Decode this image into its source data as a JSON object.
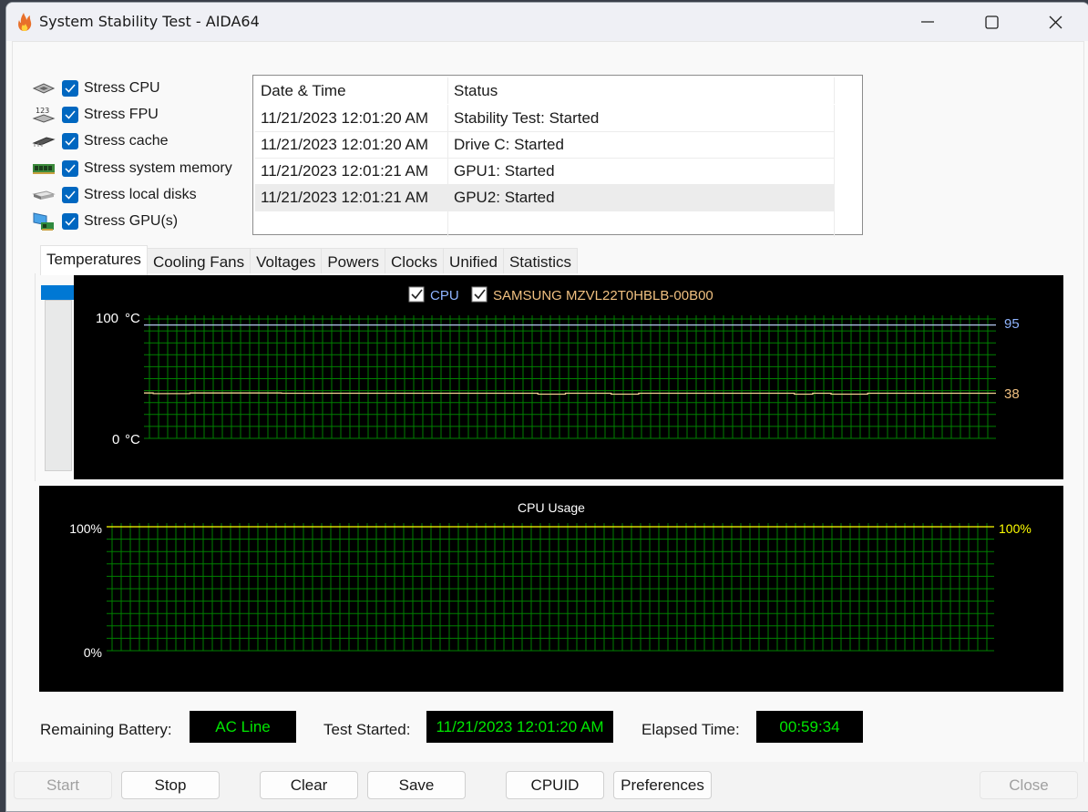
{
  "window": {
    "title": "System Stability Test - AIDA64",
    "controls": {
      "minimize": "minimize",
      "maximize": "maximize",
      "close": "close"
    }
  },
  "stress_options": [
    {
      "label": "Stress CPU",
      "checked": true,
      "icon": "cpu-chip-icon"
    },
    {
      "label": "Stress FPU",
      "checked": true,
      "icon": "fpu-chip-icon"
    },
    {
      "label": "Stress cache",
      "checked": true,
      "icon": "cache-chip-icon"
    },
    {
      "label": "Stress system memory",
      "checked": true,
      "icon": "memory-module-icon"
    },
    {
      "label": "Stress local disks",
      "checked": true,
      "icon": "disk-drive-icon"
    },
    {
      "label": "Stress GPU(s)",
      "checked": true,
      "icon": "gpu-card-icon"
    }
  ],
  "log": {
    "columns": [
      "Date & Time",
      "Status"
    ],
    "rows": [
      {
        "datetime": "11/21/2023 12:01:20 AM",
        "status": "Stability Test: Started"
      },
      {
        "datetime": "11/21/2023 12:01:20 AM",
        "status": "Drive C: Started"
      },
      {
        "datetime": "11/21/2023 12:01:21 AM",
        "status": "GPU1: Started"
      },
      {
        "datetime": "11/21/2023 12:01:21 AM",
        "status": "GPU2: Started",
        "selected": true
      }
    ]
  },
  "tabs": [
    {
      "label": "Temperatures",
      "active": true
    },
    {
      "label": "Cooling Fans"
    },
    {
      "label": "Voltages"
    },
    {
      "label": "Powers"
    },
    {
      "label": "Clocks"
    },
    {
      "label": "Unified"
    },
    {
      "label": "Statistics"
    }
  ],
  "colors": {
    "grid": "#008000",
    "cpu_series": "#b4c8f0",
    "disk_series": "#f0d090",
    "usage_series": "#ffff00",
    "status_value": "#00e600",
    "checkbox_accent": "#0067c0"
  },
  "chart_data": [
    {
      "type": "line",
      "title": "Temperatures",
      "legend": [
        {
          "name": "CPU",
          "checked": true,
          "color": "#8fb4ff"
        },
        {
          "name": "SAMSUNG MZVL22T0HBLB-00B00",
          "checked": true,
          "color": "#f0c080"
        }
      ],
      "ylabel_top": "100",
      "ylabel_bottom": "0",
      "unit": "°C",
      "ylim": [
        0,
        100
      ],
      "grid": true,
      "series": [
        {
          "name": "CPU",
          "current_label": "95",
          "values": [
            95,
            95,
            95,
            95,
            95,
            95,
            95,
            95,
            95,
            95,
            95,
            95,
            95,
            95,
            95,
            95,
            95,
            95,
            95,
            95,
            95,
            95,
            95,
            95,
            95,
            95,
            95,
            95,
            95,
            95,
            95,
            95,
            95,
            95,
            95,
            95,
            95,
            95,
            95,
            95,
            95,
            95,
            95,
            95,
            95,
            95,
            95,
            95,
            95,
            95,
            95,
            95,
            95,
            95,
            95,
            95,
            95,
            95,
            95,
            95,
            95,
            95,
            95,
            95,
            95,
            95,
            95,
            95,
            95,
            95,
            95,
            95,
            95,
            95,
            95,
            95,
            95,
            95,
            95,
            95,
            95,
            95,
            95,
            95,
            95,
            95,
            95,
            95,
            95,
            95,
            95,
            95,
            95
          ]
        },
        {
          "name": "SAMSUNG MZVL22T0HBLB-00B00",
          "current_label": "38",
          "values": [
            38,
            37.5,
            37.5,
            37.5,
            37.5,
            38,
            38,
            38,
            38,
            38,
            38,
            38,
            38,
            38,
            38,
            37.8,
            37.8,
            37.8,
            37.8,
            37.8,
            37.8,
            37.8,
            37.8,
            37.8,
            37.8,
            37.8,
            37.8,
            37.8,
            37.8,
            37.8,
            37.8,
            37.8,
            37.8,
            37.8,
            37.8,
            37.8,
            37.8,
            37.8,
            37.8,
            37.8,
            37.8,
            37.8,
            37.8,
            37,
            37,
            37,
            37.8,
            37.8,
            37.8,
            37.8,
            37.8,
            37,
            37,
            37,
            37.8,
            37.8,
            37.8,
            37.8,
            37.8,
            37.8,
            37.8,
            37.8,
            37.8,
            37.8,
            37.8,
            37.8,
            37.8,
            37.8,
            37.8,
            37.8,
            37.8,
            37,
            37,
            37.8,
            37.8,
            37,
            37,
            37,
            37,
            37.8,
            37.8,
            37.8,
            37.8,
            37.8,
            37.8,
            37.8,
            37.8,
            37.8,
            37.8,
            37.8,
            37.8,
            37.8,
            37.8
          ]
        }
      ]
    },
    {
      "type": "line",
      "title": "CPU Usage",
      "ylabel_top": "100%",
      "ylabel_bottom": "0%",
      "ylim": [
        0,
        100
      ],
      "grid": true,
      "series": [
        {
          "name": "CPU Usage",
          "current_label": "100%",
          "values": [
            100,
            100,
            100,
            100,
            100,
            100,
            100,
            100,
            100,
            100
          ]
        }
      ]
    }
  ],
  "status": {
    "battery_label": "Remaining Battery:",
    "battery_value": "AC Line",
    "started_label": "Test Started:",
    "started_value": "11/21/2023 12:01:20 AM",
    "elapsed_label": "Elapsed Time:",
    "elapsed_value": "00:59:34"
  },
  "buttons": {
    "start": {
      "label": "Start",
      "enabled": false
    },
    "stop": {
      "label": "Stop",
      "enabled": true
    },
    "clear": {
      "label": "Clear",
      "enabled": true
    },
    "save": {
      "label": "Save",
      "enabled": true
    },
    "cpuid": {
      "label": "CPUID",
      "enabled": true
    },
    "preferences": {
      "label": "Preferences",
      "enabled": true
    },
    "close": {
      "label": "Close",
      "enabled": false
    }
  }
}
